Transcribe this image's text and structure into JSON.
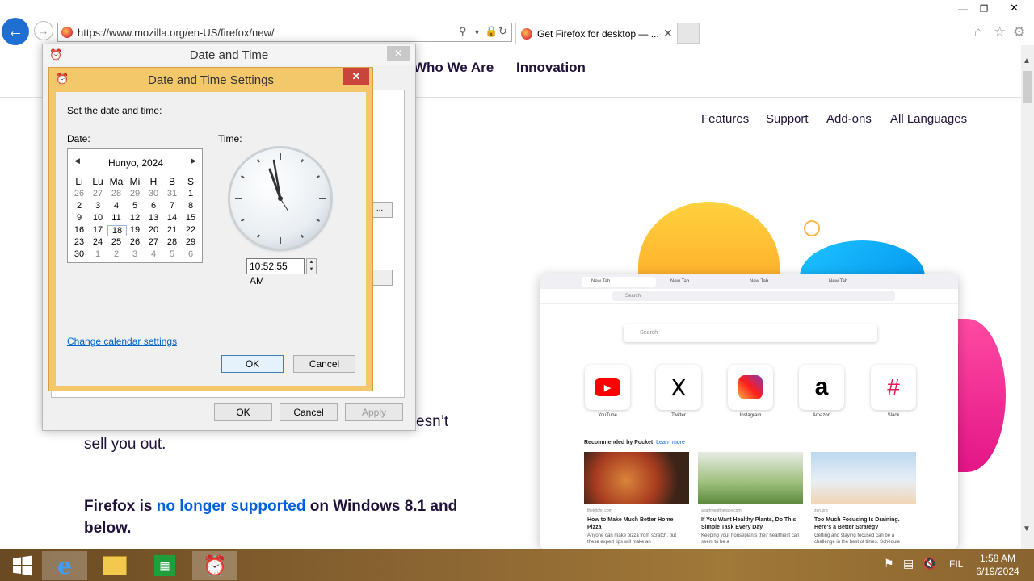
{
  "browser": {
    "url": "https://www.mozilla.org/en-US/firefox/new/",
    "tab_title": "Get Firefox for desktop — ...",
    "tab_close": "✕"
  },
  "site": {
    "nav": [
      "Who We Are",
      "Innovation"
    ],
    "subnav": [
      "Features",
      "Support",
      "Add-ons",
      "All Languages"
    ],
    "body_fragment_1": "esn’t",
    "body_fragment_2": "sell you out.",
    "warning_prefix": "Firefox is ",
    "warning_link": "no longer supported",
    "warning_suffix": " on Windows 8.1 and below."
  },
  "mockup": {
    "tabs": [
      "New Tab",
      "New Tab",
      "New Tab",
      "New Tab"
    ],
    "url_placeholder": "Search",
    "search_placeholder": "Search",
    "shortcuts": [
      "YouTube",
      "Twitter",
      "Instagram",
      "Amazon",
      "Slack"
    ],
    "pocket_heading": "Recommended by Pocket",
    "pocket_learn": "Learn more",
    "cards": [
      {
        "source": "thekitchn.com",
        "title": "How to Make Much Better Home Pizza",
        "body": "Anyone can make pizza from scratch, but these expert tips will make an"
      },
      {
        "source": "apartmenttherapy.com",
        "title": "If You Want Healthy Plants, Do This Simple Task Every Day",
        "body": "Keeping your houseplants their healthiest can seem to be a"
      },
      {
        "source": "zen.org",
        "title": "Too Much Focusing Is Draining. Here's a Better Strategy",
        "body": "Getting and staying focused can be a challenge in the best of times. Schedule"
      }
    ]
  },
  "dt_dialog": {
    "title": "Date and Time",
    "ok": "OK",
    "cancel": "Cancel",
    "apply": "Apply",
    "partial_btn": "..."
  },
  "dts_dialog": {
    "title": "Date and Time Settings",
    "prompt": "Set the date and time:",
    "date_label": "Date:",
    "time_label": "Time:",
    "month": "Hunyo, 2024",
    "weekdays": [
      "Li",
      "Lu",
      "Ma",
      "Mi",
      "H",
      "B",
      "S"
    ],
    "weeks": [
      [
        "26",
        "27",
        "28",
        "29",
        "30",
        "31",
        "1"
      ],
      [
        "2",
        "3",
        "4",
        "5",
        "6",
        "7",
        "8"
      ],
      [
        "9",
        "10",
        "11",
        "12",
        "13",
        "14",
        "15"
      ],
      [
        "16",
        "17",
        "18",
        "19",
        "20",
        "21",
        "22"
      ],
      [
        "23",
        "24",
        "25",
        "26",
        "27",
        "28",
        "29"
      ],
      [
        "30",
        "1",
        "2",
        "3",
        "4",
        "5",
        "6"
      ]
    ],
    "time_value": "10:52:55 AM",
    "calendar_link": "Change calendar settings",
    "ok": "OK",
    "cancel": "Cancel"
  },
  "taskbar": {
    "lang": "FIL",
    "time": "1:58 AM",
    "date": "6/19/2024"
  }
}
